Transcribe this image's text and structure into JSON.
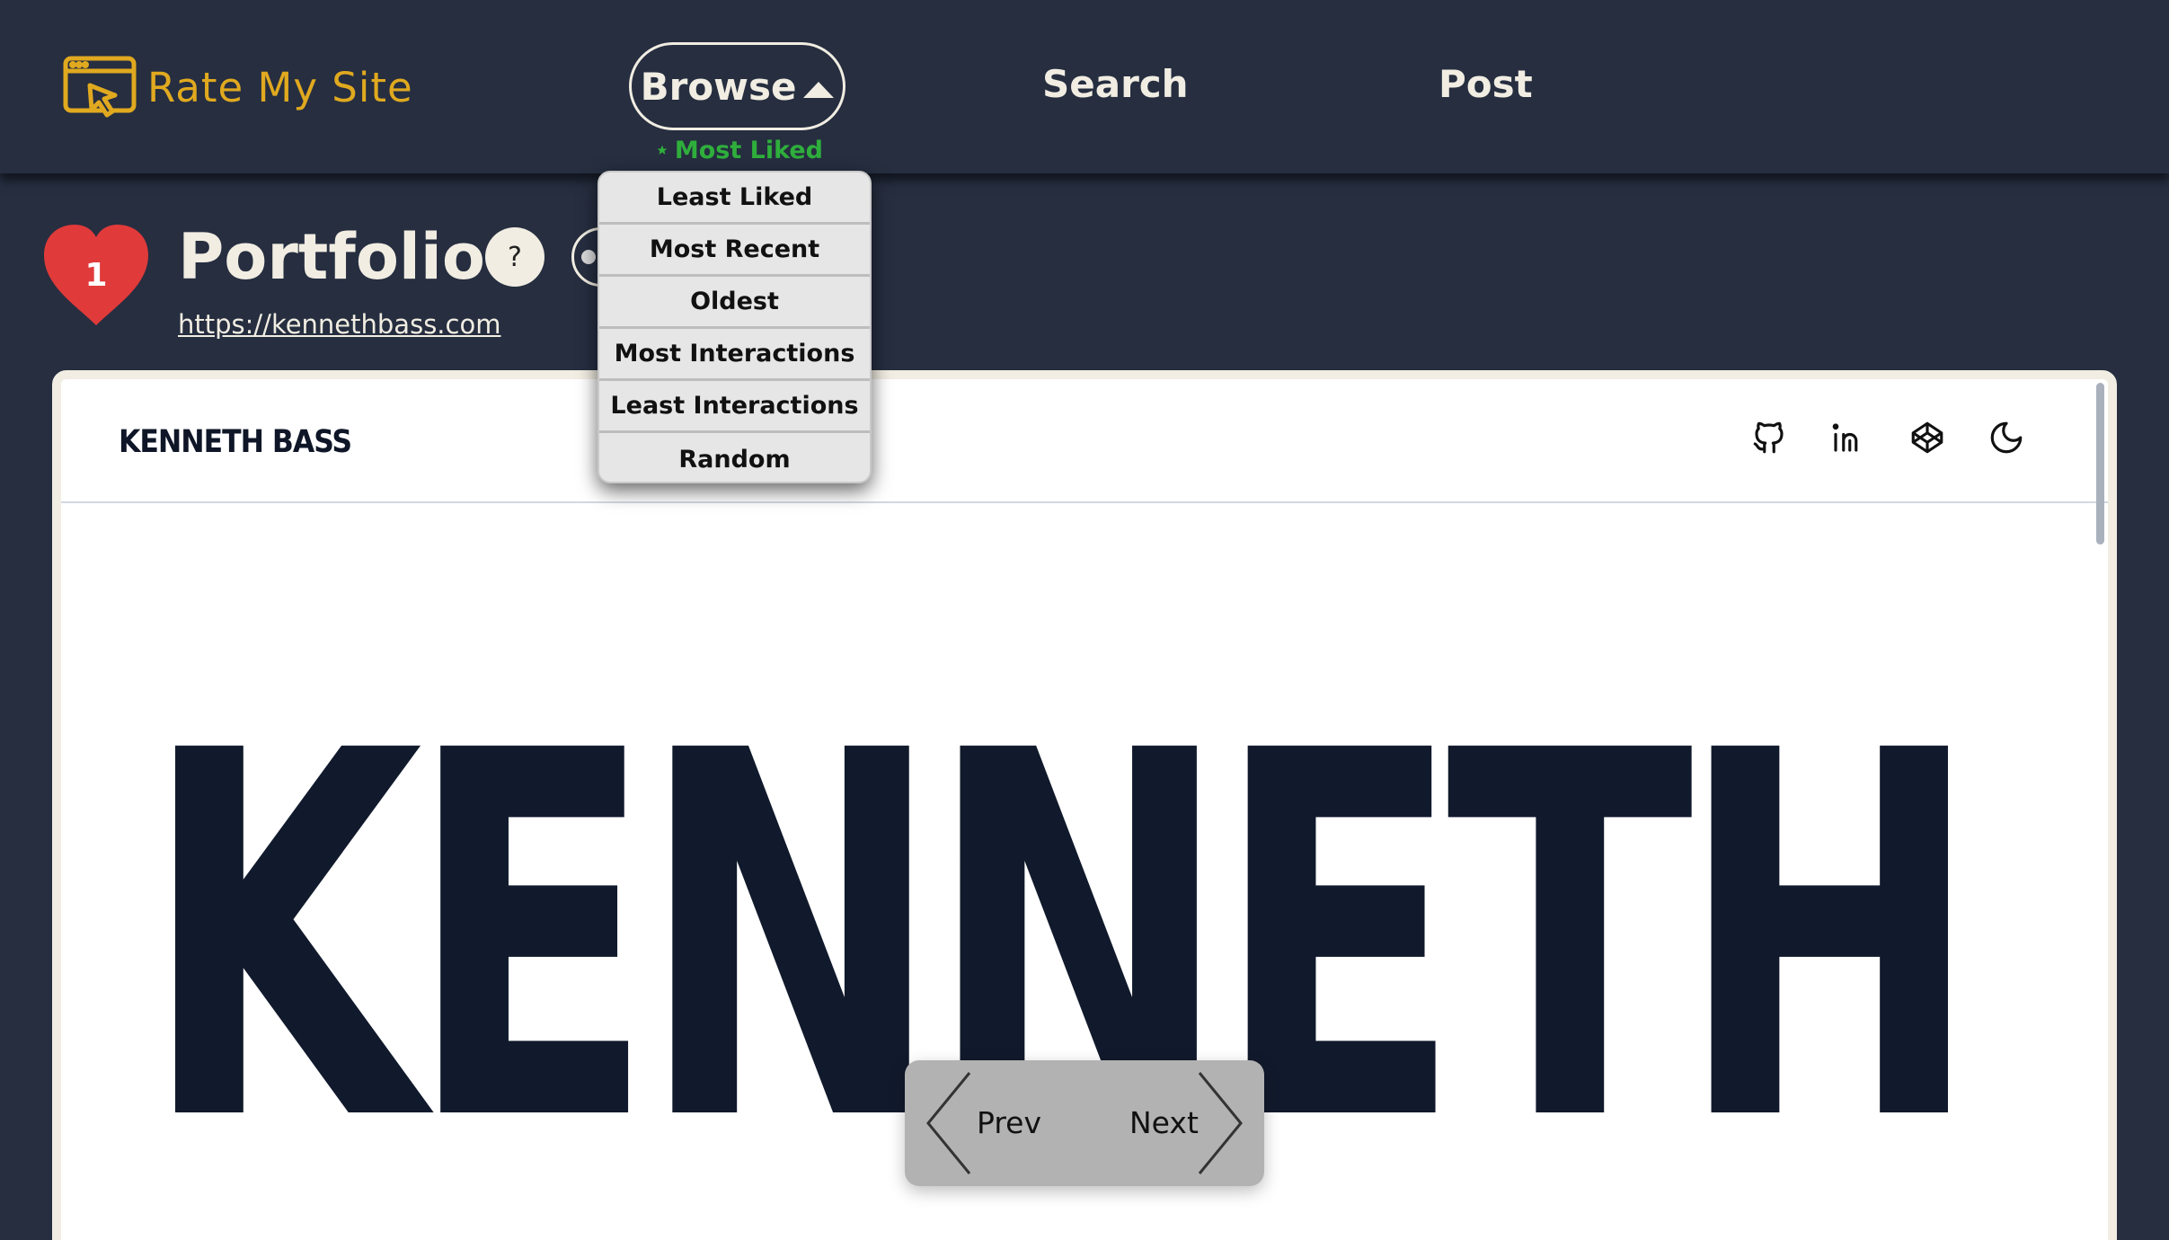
{
  "app": {
    "logo_text": "Rate My Site",
    "logo_icon": "browser-cursor-icon",
    "brand_color": "#e0a91f"
  },
  "nav": {
    "browse_label": "Browse",
    "search_label": "Search",
    "post_label": "Post",
    "current_sort": "Most Liked",
    "current_sort_icon": "star-icon",
    "current_sort_color": "#2fae3c"
  },
  "sort_menu": {
    "options": [
      "Least Liked",
      "Most Recent",
      "Oldest",
      "Most Interactions",
      "Least Interactions",
      "Random"
    ]
  },
  "site": {
    "likes": "1",
    "title": "Portfolio",
    "help_label": "?",
    "url": "https://kennethbass.com"
  },
  "preview": {
    "brand": "KENNETH BASS",
    "hero_text": "KENNETH",
    "icons": [
      "github-icon",
      "linkedin-icon",
      "codepen-icon",
      "moon-icon"
    ]
  },
  "pager": {
    "prev_label": "Prev",
    "next_label": "Next"
  },
  "colors": {
    "background": "#262e40",
    "text": "#f1ede2",
    "heart": "#e03a3a"
  }
}
